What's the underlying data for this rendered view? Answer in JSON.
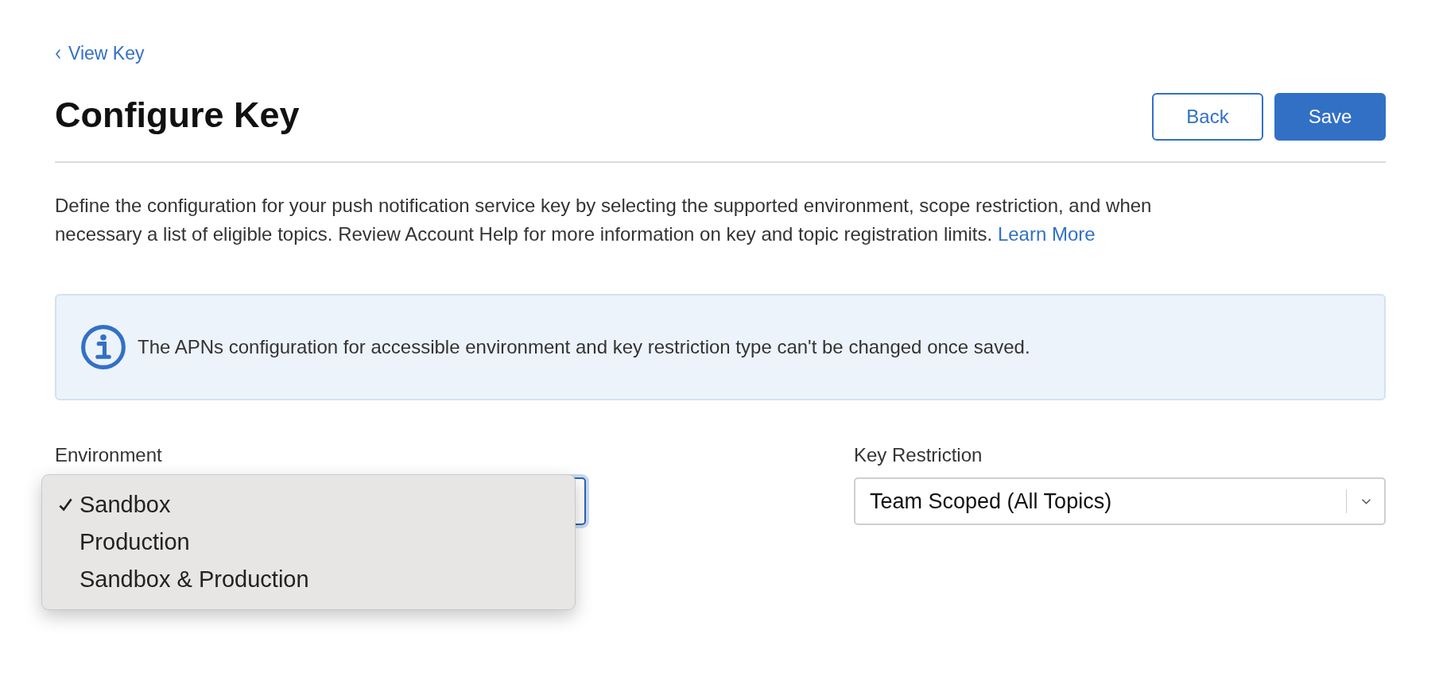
{
  "back_link": {
    "label": "View Key"
  },
  "title": "Configure Key",
  "buttons": [
    {
      "label": "Back",
      "kind": "secondary"
    },
    {
      "label": "Save",
      "kind": "primary"
    }
  ],
  "description": {
    "text": "Define the configuration for your push notification service key by selecting the supported environment, scope restriction, and when necessary a list of eligible topics. Review Account Help for more information on key and topic registration limits.",
    "link": "Learn More"
  },
  "notice": {
    "text": "The APNs configuration for accessible environment and key restriction type can't be changed once saved."
  },
  "environment": {
    "label": "Environment",
    "focused": true,
    "menu": [
      {
        "label": "Sandbox",
        "selected": true
      },
      {
        "label": "Production",
        "selected": false
      },
      {
        "label": "Sandbox & Production",
        "selected": false
      }
    ]
  },
  "key_restriction": {
    "label": "Key Restriction",
    "value": "Team Scoped (All Topics)"
  }
}
